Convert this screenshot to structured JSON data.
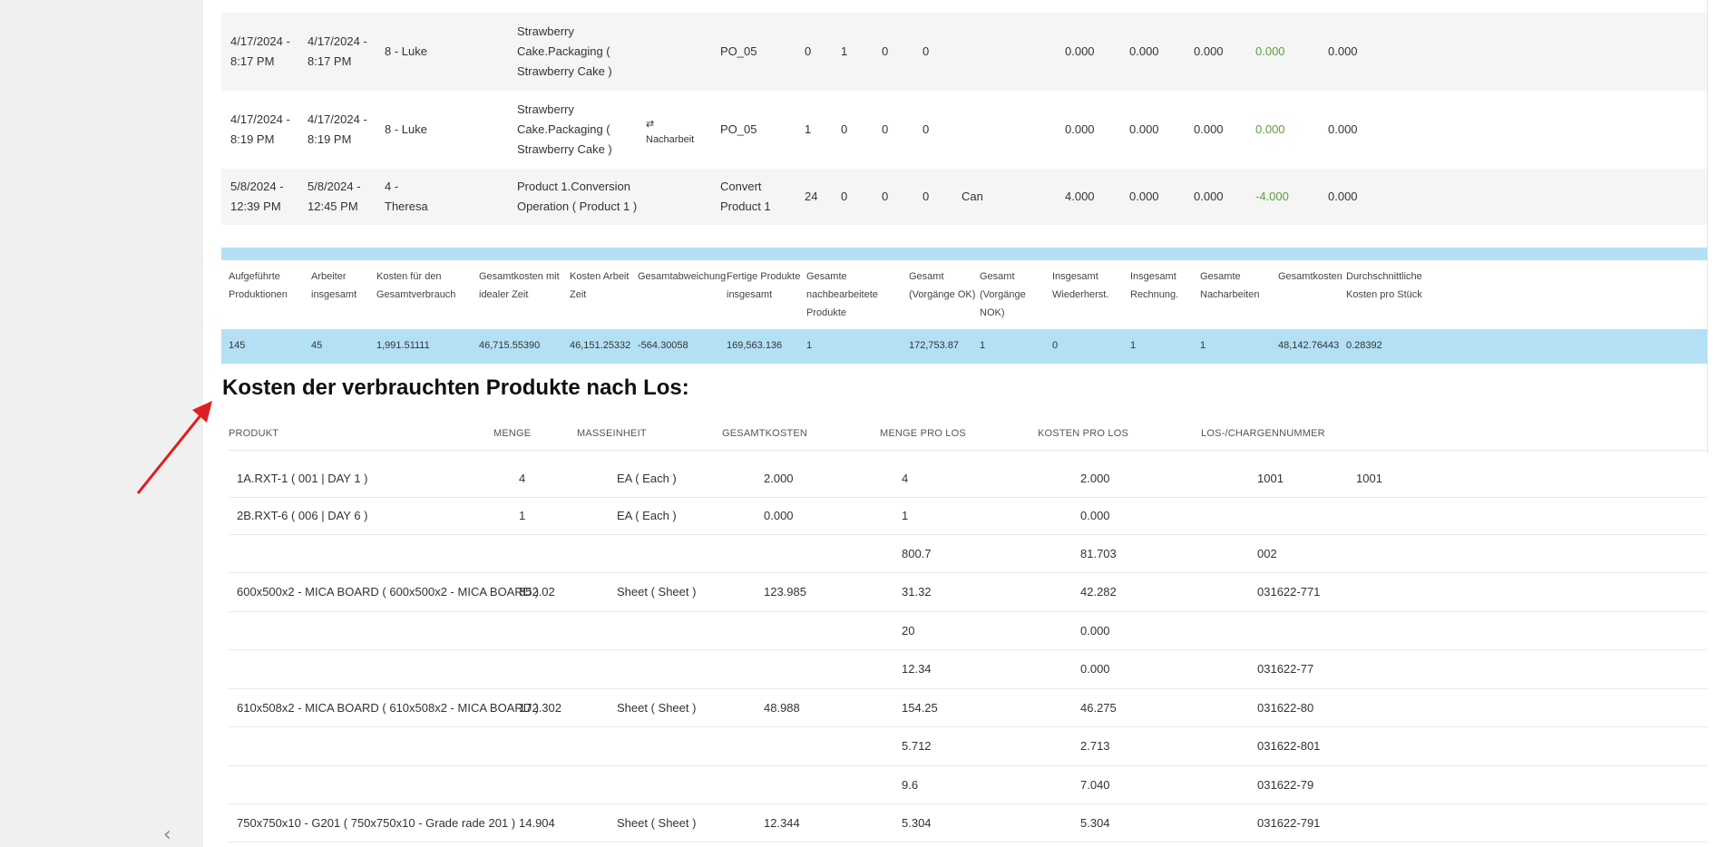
{
  "records": [
    {
      "start": [
        "4/17/2024 -",
        "8:17 PM"
      ],
      "end": [
        "4/17/2024 -",
        "8:17 PM"
      ],
      "worker": [
        "8 - Luke"
      ],
      "product": [
        "Strawberry",
        "Cake.Packaging (",
        "Strawberry Cake )"
      ],
      "rework": "",
      "order": [
        "PO_05"
      ],
      "n1": "0",
      "n2": "1",
      "n3": "0",
      "n4": "0",
      "reason": "",
      "c1": "0.000",
      "c2": "0.000",
      "c3": "0.000",
      "c4": "0.000",
      "c5": "0.000"
    },
    {
      "start": [
        "4/17/2024 -",
        "8:19 PM"
      ],
      "end": [
        "4/17/2024 -",
        "8:19 PM"
      ],
      "worker": [
        "8 - Luke"
      ],
      "product": [
        "Strawberry",
        "Cake.Packaging (",
        "Strawberry Cake )"
      ],
      "rework": "Nacharbeit",
      "order": [
        "PO_05"
      ],
      "n1": "1",
      "n2": "0",
      "n3": "0",
      "n4": "0",
      "reason": "",
      "c1": "0.000",
      "c2": "0.000",
      "c3": "0.000",
      "c4": "0.000",
      "c5": "0.000"
    },
    {
      "start": [
        "5/8/2024 -",
        "12:39 PM"
      ],
      "end": [
        "5/8/2024 -",
        "12:45 PM"
      ],
      "worker": [
        "4 -",
        "Theresa"
      ],
      "product": [
        "Product 1.Conversion",
        "Operation ( Product 1 )"
      ],
      "rework": "",
      "order": [
        "Convert",
        "Product 1"
      ],
      "n1": "24",
      "n2": "0",
      "n3": "0",
      "n4": "0",
      "reason": "Can",
      "c1": "4.000",
      "c2": "0.000",
      "c3": "0.000",
      "c4": "-4.000",
      "c5": "0.000"
    }
  ],
  "summary": {
    "headers": [
      [
        "Aufgeführte",
        "Produktionen"
      ],
      [
        "Arbeiter",
        "insgesamt"
      ],
      [
        "Kosten für den",
        "Gesamtverbrauch"
      ],
      [
        "Gesamtkosten mit",
        "idealer Zeit"
      ],
      [
        "Kosten Arbeit",
        "Zeit"
      ],
      [
        "Gesamtabweichung"
      ],
      [
        "Fertige Produkte",
        "insgesamt"
      ],
      [
        "Gesamte",
        "nachbearbeitete",
        "Produkte"
      ],
      [
        "Gesamt",
        "(Vorgänge OK)"
      ],
      [
        "Gesamt",
        "(Vorgänge",
        "NOK)"
      ],
      [
        "Insgesamt",
        "Wiederherst."
      ],
      [
        "Insgesamt",
        "Rechnung."
      ],
      [
        "Gesamte",
        "Nacharbeiten"
      ],
      [
        "Gesamtkosten"
      ],
      [
        "Durchschnittliche",
        "Kosten pro Stück"
      ]
    ],
    "values": [
      "145",
      "45",
      "1,991.51111",
      "46,715.55390",
      "46,151.25332",
      "-564.30058",
      "169,563.136",
      "1",
      "172,753.87",
      "1",
      "0",
      "1",
      "1",
      "48,142.76443",
      "0.28392"
    ]
  },
  "los": {
    "title": "Kosten der verbrauchten Produkte nach Los:",
    "headers": [
      "PRODUKT",
      "MENGE",
      "MASSEINHEIT",
      "GESAMTKOSTEN",
      "MENGE PRO LOS",
      "KOSTEN PRO LOS",
      "LOS-/CHARGENNUMMER"
    ],
    "lines": [
      {
        "product": "1A.RXT-1 ( 001 | DAY 1 )",
        "menge": "4",
        "unit": "EA ( Each )",
        "total": "2.000",
        "qty": "4",
        "cost": "2.000",
        "lot": "1001",
        "extra": "1001"
      },
      {
        "product": "2B.RXT-6 ( 006 | DAY 6 )",
        "menge": "1",
        "unit": "EA ( Each )",
        "total": "0.000",
        "qty": "1",
        "cost": "0.000",
        "lot": "",
        "extra": ""
      },
      {
        "product": "",
        "menge": "",
        "unit": "",
        "total": "",
        "qty": "800.7",
        "cost": "81.703",
        "lot": "002",
        "extra": ""
      },
      {
        "product": "600x500x2 - MICA BOARD ( 600x500x2 - MICA BOARD )",
        "menge": "852.02",
        "unit": "Sheet ( Sheet )",
        "total": "123.985",
        "qty": "31.32",
        "cost": "42.282",
        "lot": "031622-771",
        "extra": ""
      },
      {
        "product": "",
        "menge": "",
        "unit": "",
        "total": "",
        "qty": "20",
        "cost": "0.000",
        "lot": "",
        "extra": ""
      },
      {
        "product": "",
        "menge": "",
        "unit": "",
        "total": "",
        "qty": "12.34",
        "cost": "0.000",
        "lot": "031622-77",
        "extra": ""
      },
      {
        "product": "610x508x2 - MICA BOARD ( 610x508x2 - MICA BOARD )",
        "menge": "172.302",
        "unit": "Sheet ( Sheet )",
        "total": "48.988",
        "qty": "154.25",
        "cost": "46.275",
        "lot": "031622-80",
        "extra": ""
      },
      {
        "product": "",
        "menge": "",
        "unit": "",
        "total": "",
        "qty": "5.712",
        "cost": "2.713",
        "lot": "031622-801",
        "extra": ""
      },
      {
        "product": "",
        "menge": "",
        "unit": "",
        "total": "",
        "qty": "9.6",
        "cost": "7.040",
        "lot": "031622-79",
        "extra": ""
      },
      {
        "product": "750x750x10 - G201 ( 750x750x10 - Grade rade 201 )",
        "menge": "14.904",
        "unit": "Sheet ( Sheet )",
        "total": "12.344",
        "qty": "5.304",
        "cost": "5.304",
        "lot": "031622-791",
        "extra": ""
      }
    ]
  },
  "icons": {
    "rework": "repeat-icon",
    "sidebar_toggle": "chevron-left-icon"
  },
  "colors": {
    "highlight": "#b3e0f5",
    "positive_green": "#5a9e3a",
    "arrow": "#e02020"
  }
}
